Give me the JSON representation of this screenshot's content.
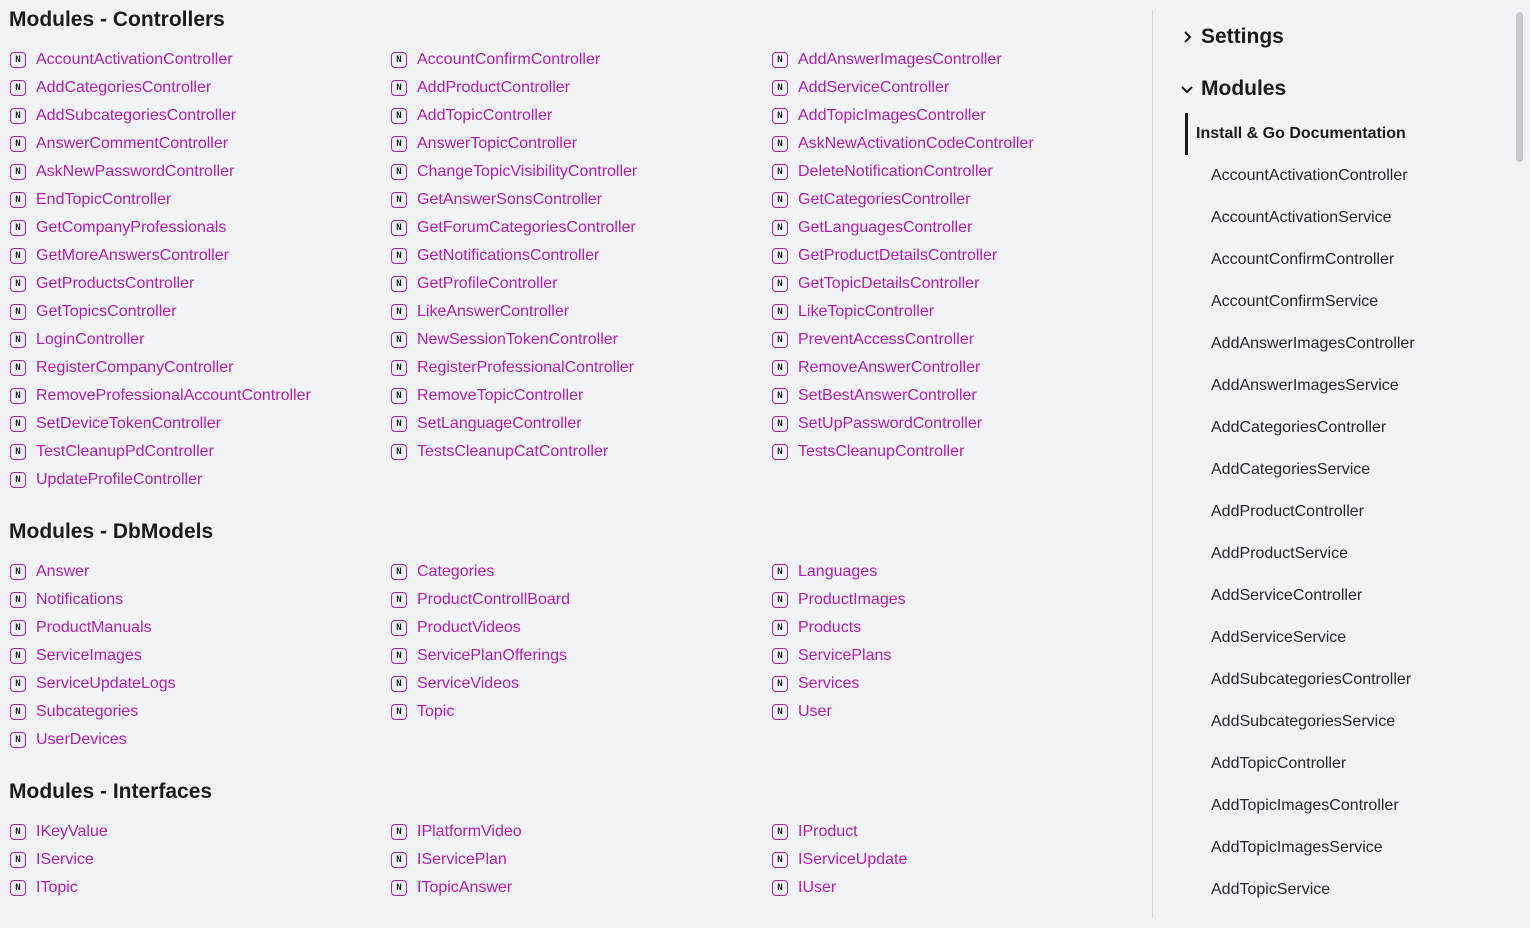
{
  "sections": [
    {
      "title": "Modules - Controllers",
      "items": [
        "AccountActivationController",
        "AccountConfirmController",
        "AddAnswerImagesController",
        "AddCategoriesController",
        "AddProductController",
        "AddServiceController",
        "AddSubcategoriesController",
        "AddTopicController",
        "AddTopicImagesController",
        "AnswerCommentController",
        "AnswerTopicController",
        "AskNewActivationCodeController",
        "AskNewPasswordController",
        "ChangeTopicVisibilityController",
        "DeleteNotificationController",
        "EndTopicController",
        "GetAnswerSonsController",
        "GetCategoriesController",
        "GetCompanyProfessionals",
        "GetForumCategoriesController",
        "GetLanguagesController",
        "GetMoreAnswersController",
        "GetNotificationsController",
        "GetProductDetailsController",
        "GetProductsController",
        "GetProfileController",
        "GetTopicDetailsController",
        "GetTopicsController",
        "LikeAnswerController",
        "LikeTopicController",
        "LoginController",
        "NewSessionTokenController",
        "PreventAccessController",
        "RegisterCompanyController",
        "RegisterProfessionalController",
        "RemoveAnswerController",
        "RemoveProfessionalAccountController",
        "RemoveTopicController",
        "SetBestAnswerController",
        "SetDeviceTokenController",
        "SetLanguageController",
        "SetUpPasswordController",
        "TestCleanupPdController",
        "TestsCleanupCatController",
        "TestsCleanupController",
        "UpdateProfileController"
      ]
    },
    {
      "title": "Modules - DbModels",
      "items": [
        "Answer",
        "Categories",
        "Languages",
        "Notifications",
        "ProductControllBoard",
        "ProductImages",
        "ProductManuals",
        "ProductVideos",
        "Products",
        "ServiceImages",
        "ServicePlanOfferings",
        "ServicePlans",
        "ServiceUpdateLogs",
        "ServiceVideos",
        "Services",
        "Subcategories",
        "Topic",
        "User",
        "UserDevices"
      ]
    },
    {
      "title": "Modules - Interfaces",
      "items": [
        "IKeyValue",
        "IPlatformVideo",
        "IProduct",
        "IService",
        "IServicePlan",
        "IServiceUpdate",
        "ITopic",
        "ITopicAnswer",
        "IUser"
      ]
    }
  ],
  "icon_glyph": "N",
  "sidebar": {
    "settings_label": "Settings",
    "modules_label": "Modules",
    "active_item": "Install & Go Documentation",
    "items": [
      "AccountActivationController",
      "AccountActivationService",
      "AccountConfirmController",
      "AccountConfirmService",
      "AddAnswerImagesController",
      "AddAnswerImagesService",
      "AddCategoriesController",
      "AddCategoriesService",
      "AddProductController",
      "AddProductService",
      "AddServiceController",
      "AddServiceService",
      "AddSubcategoriesController",
      "AddSubcategoriesService",
      "AddTopicController",
      "AddTopicImagesController",
      "AddTopicImagesService",
      "AddTopicService"
    ]
  },
  "colors": {
    "link": "#b31db3",
    "icon_border": "#b71cb7",
    "background": "#f2f3f7"
  }
}
